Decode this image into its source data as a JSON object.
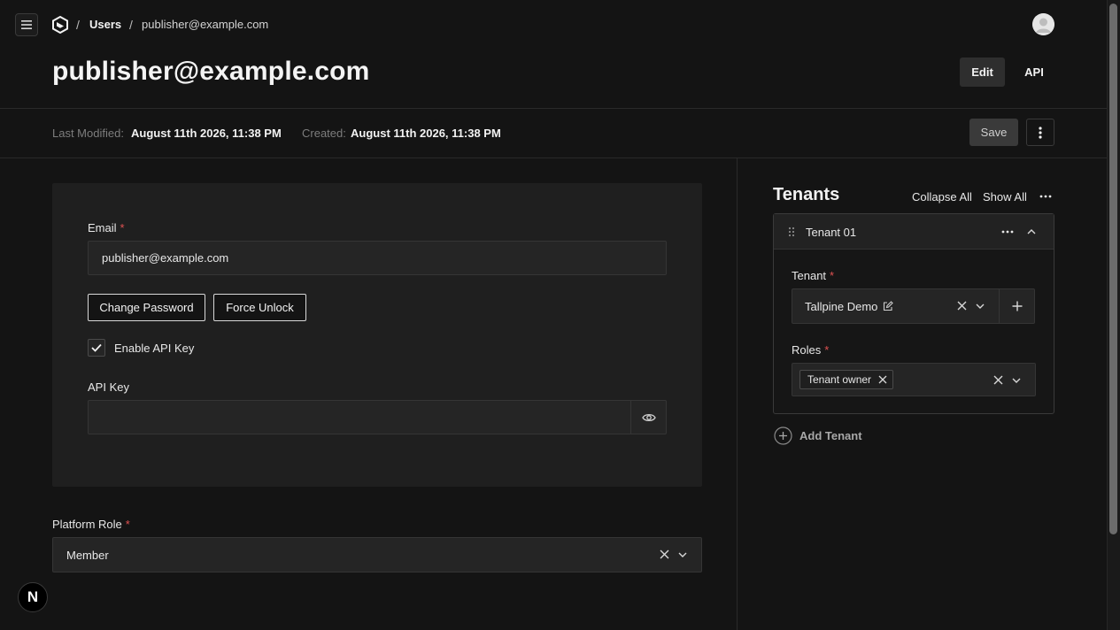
{
  "breadcrumb": {
    "separator": "/",
    "users": "Users",
    "current": "publisher@example.com"
  },
  "page": {
    "title": "publisher@example.com"
  },
  "tabs": {
    "edit": "Edit",
    "api": "API"
  },
  "meta": {
    "modified_label": "Last Modified:",
    "modified_value": "August 11th 2026, 11:38 PM",
    "created_label": "Created:",
    "created_value": "August 11th 2026, 11:38 PM"
  },
  "actions": {
    "save": "Save"
  },
  "form": {
    "email_label": "Email",
    "email_value": "publisher@example.com",
    "required_mark": "*",
    "change_password": "Change Password",
    "force_unlock": "Force Unlock",
    "enable_api_key_label": "Enable API Key",
    "enable_api_key_checked": true,
    "api_key_label": "API Key",
    "api_key_value": "",
    "platform_role_label": "Platform Role",
    "platform_role_value": "Member"
  },
  "tenants": {
    "title": "Tenants",
    "collapse_all": "Collapse All",
    "show_all": "Show All",
    "row_title": "Tenant 01",
    "tenant_label": "Tenant",
    "tenant_value": "Tallpine Demo",
    "roles_label": "Roles",
    "role_chip": "Tenant owner",
    "add_tenant": "Add Tenant"
  },
  "badge": {
    "letter": "N"
  },
  "icons": [
    "menu-icon",
    "logo-icon",
    "avatar-icon",
    "more-vertical-icon",
    "check-icon",
    "eye-icon",
    "clear-icon",
    "chevron-down-icon",
    "more-horizontal-icon",
    "chevron-up-icon",
    "drag-handle-icon",
    "edit-icon",
    "plus-icon",
    "add-circle-icon"
  ],
  "colors": {
    "background": "#141414",
    "required": "#e05252",
    "card": "#1f1f1f"
  }
}
